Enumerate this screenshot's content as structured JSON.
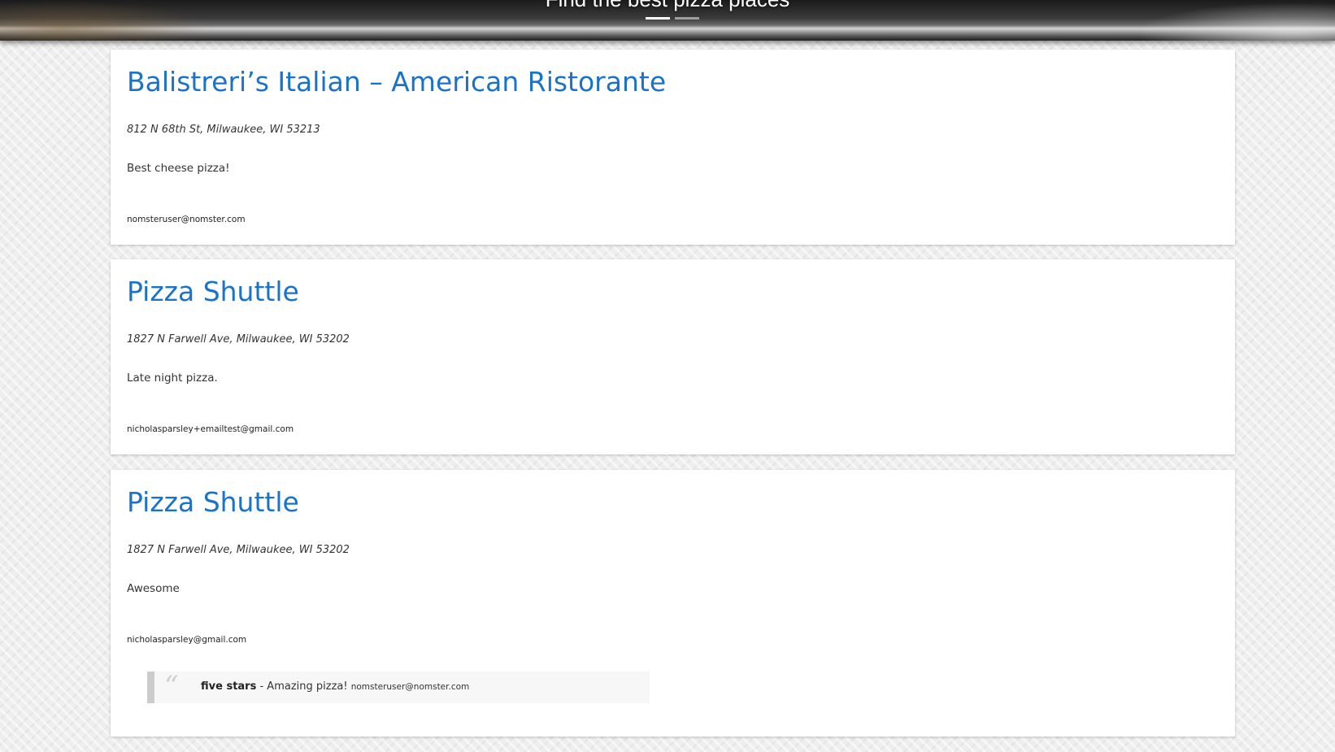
{
  "hero": {
    "title": "Find the best pizza places",
    "slide_count": 2,
    "active_slide": 1
  },
  "places": [
    {
      "name": "Balistreri’s Italian – American Ristorante",
      "address": "812 N 68th St, Milwaukee, WI 53213",
      "description": "Best cheese pizza!",
      "user_email": "nomsteruser@nomster.com"
    },
    {
      "name": "Pizza Shuttle",
      "address": "1827 N Farwell Ave, Milwaukee, WI 53202",
      "description": "Late night pizza.",
      "user_email": "nicholasparsley+emailtest@gmail.com"
    },
    {
      "name": "Pizza Shuttle",
      "address": "1827 N Farwell Ave, Milwaukee, WI 53202",
      "description": "Awesome",
      "user_email": "nicholasparsley@gmail.com",
      "comment": {
        "rating": "five stars",
        "separator": " - ",
        "message": "Amazing pizza!",
        "user_email": "nomsteruser@nomster.com"
      }
    }
  ],
  "colors": {
    "link": "#1a73c8",
    "card_background": "#ffffff",
    "page_background": "#eeeeee",
    "comment_border": "#cccccc"
  }
}
